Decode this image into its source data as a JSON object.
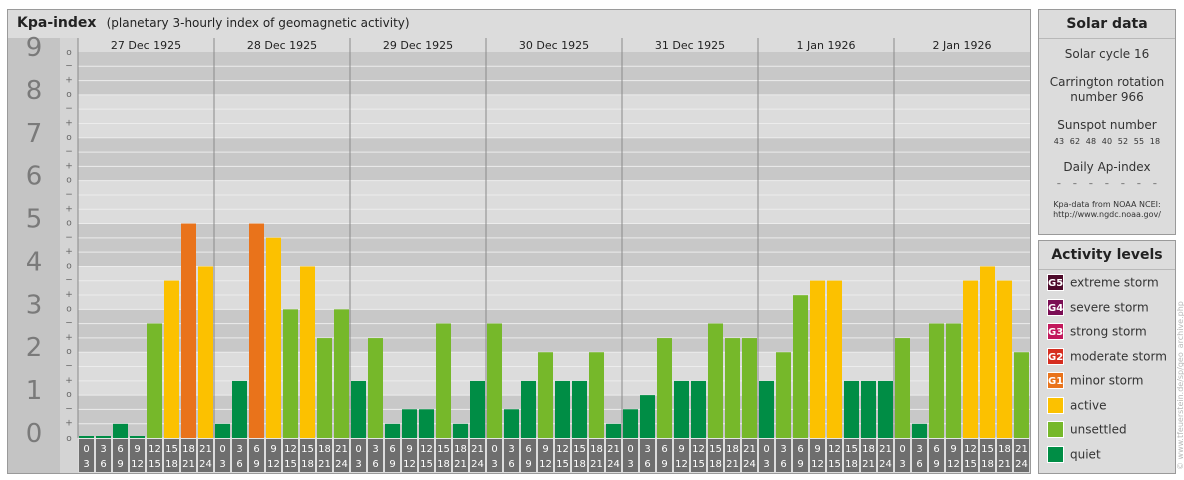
{
  "header": {
    "title": "Kpa-index",
    "subtitle": "(planetary 3-hourly index of geomagnetic activity)"
  },
  "chart_data": {
    "type": "bar",
    "title": "Kpa-index",
    "subtitle": "(planetary 3-hourly index of geomagnetic activity)",
    "ylim": [
      0,
      9
    ],
    "y_ticks": [
      "0",
      "1",
      "2",
      "3",
      "4",
      "5",
      "6",
      "7",
      "8",
      "9"
    ],
    "y_minor_ticks": [
      "o",
      "+",
      "−"
    ],
    "days": [
      "27 Dec 1925",
      "28 Dec 1925",
      "29 Dec 1925",
      "30 Dec 1925",
      "31 Dec 1925",
      "1 Jan 1926",
      "2 Jan 1926"
    ],
    "interval_start_labels": [
      "0",
      "3",
      "6",
      "9",
      "12",
      "15",
      "18",
      "21"
    ],
    "interval_end_labels": [
      "3",
      "6",
      "9",
      "12",
      "15",
      "18",
      "21",
      "24"
    ],
    "values": [
      [
        0.0,
        0.0,
        0.33,
        0.0,
        2.67,
        3.67,
        5.0,
        4.0
      ],
      [
        0.33,
        1.33,
        5.0,
        4.67,
        3.0,
        4.0,
        2.33,
        3.0
      ],
      [
        1.33,
        2.33,
        0.33,
        0.67,
        0.67,
        2.67,
        0.33,
        1.33
      ],
      [
        2.67,
        0.67,
        1.33,
        2.0,
        1.33,
        1.33,
        2.0,
        0.33
      ],
      [
        0.67,
        1.0,
        2.33,
        1.33,
        1.33,
        2.67,
        2.33,
        2.33
      ],
      [
        1.33,
        2.0,
        3.33,
        3.67,
        3.67,
        1.33,
        1.33,
        1.33
      ],
      [
        2.33,
        0.33,
        2.67,
        2.67,
        3.67,
        4.0,
        3.67,
        2.0
      ]
    ],
    "level_colors": {
      "quiet": "#008d45",
      "unsettled": "#76b82a",
      "active": "#fcc100",
      "minor": "#e9731b",
      "moderate": "#d62d20",
      "strong": "#c2185b",
      "severe": "#7b0d54",
      "extreme": "#4d0a2a"
    },
    "grid": true
  },
  "solar": {
    "title": "Solar data",
    "cycle_label": "Solar cycle 16",
    "carrington_line1": "Carrington rotation",
    "carrington_line2": "number 966",
    "sunspot_title": "Sunspot number",
    "sunspot_values": [
      "43",
      "62",
      "48",
      "40",
      "52",
      "55",
      "18"
    ],
    "ap_title": "Daily Ap-index",
    "ap_values": [
      "–",
      "–",
      "–",
      "–",
      "–",
      "–",
      "–"
    ],
    "credit_line1": "Kpa-data from NOAA NCEI:",
    "credit_line2": "http://www.ngdc.noaa.gov/"
  },
  "legend": {
    "title": "Activity levels",
    "items": [
      {
        "code": "G5",
        "label": "extreme storm",
        "color": "#4d0a2a"
      },
      {
        "code": "G4",
        "label": "severe storm",
        "color": "#7b0d54"
      },
      {
        "code": "G3",
        "label": "strong storm",
        "color": "#c2185b"
      },
      {
        "code": "G2",
        "label": "moderate storm",
        "color": "#d62d20"
      },
      {
        "code": "G1",
        "label": "minor storm",
        "color": "#e9731b"
      },
      {
        "code": "",
        "label": "active",
        "color": "#fcc100"
      },
      {
        "code": "",
        "label": "unsettled",
        "color": "#76b82a"
      },
      {
        "code": "",
        "label": "quiet",
        "color": "#008d45"
      }
    ]
  },
  "watermark": "© www.tfeuerstein.de/sp/geo_archive.php"
}
